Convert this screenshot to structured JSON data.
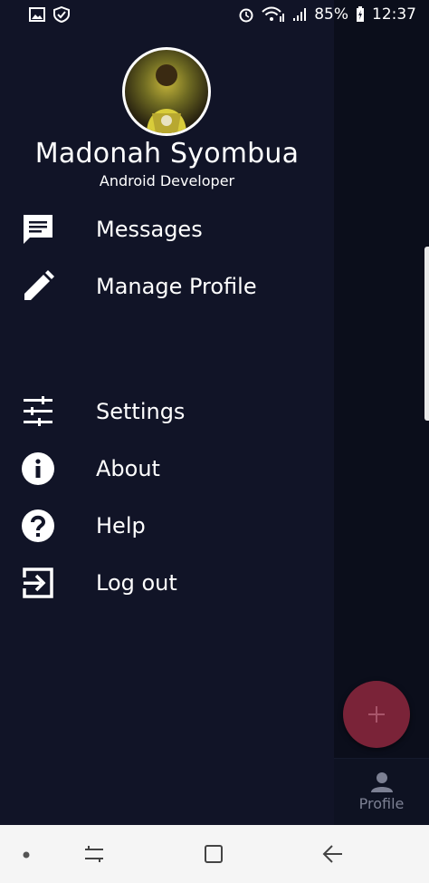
{
  "status_bar": {
    "battery": "85%",
    "time": "12:37"
  },
  "drawer": {
    "user_name": "Madonah Syombua",
    "user_role": "Android Developer",
    "items": [
      {
        "label": "Messages",
        "icon": "message-icon"
      },
      {
        "label": "Manage Profile",
        "icon": "pencil-icon"
      },
      {
        "label": "Settings",
        "icon": "tune-icon"
      },
      {
        "label": "About",
        "icon": "info-icon"
      },
      {
        "label": "Help",
        "icon": "help-icon"
      },
      {
        "label": "Log out",
        "icon": "logout-icon"
      }
    ]
  },
  "bottom_nav": {
    "profile_label": "Profile"
  },
  "colors": {
    "drawer_bg": "#111427",
    "fab": "#7a2338"
  }
}
